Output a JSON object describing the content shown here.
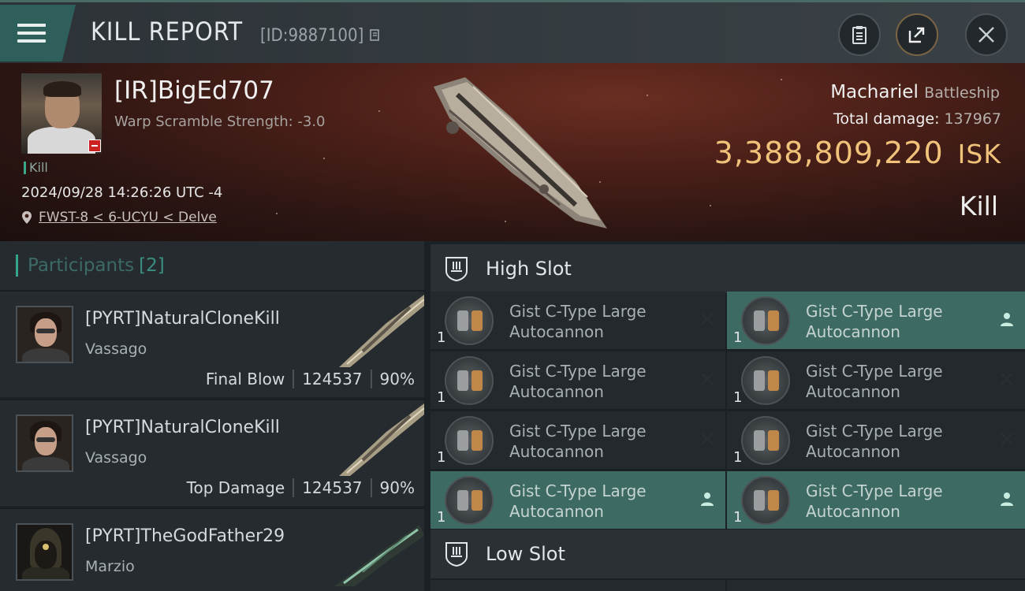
{
  "header": {
    "title": "KILL REPORT",
    "report_id": "[ID:9887100]"
  },
  "victim": {
    "name": "[IR]BigEd707",
    "warp_scramble": "Warp Scramble Strength: -3.0",
    "kill_tag": "Kill",
    "datetime": "2024/09/28 14:26:26 UTC -4",
    "location": "FWST-8 < 6-UCYU < Delve",
    "ship": "Machariel",
    "ship_class": "Battleship",
    "total_damage_label": "Total damage:",
    "total_damage": "137967",
    "isk_value": "3,388,809,220",
    "isk_unit": "ISK",
    "result": "Kill"
  },
  "participants": {
    "label": "Participants",
    "count": "[2]",
    "items": [
      {
        "name": "[PYRT]NaturalCloneKill",
        "ship": "Vassago",
        "role": "Final Blow",
        "damage": "124537",
        "percent": "90%"
      },
      {
        "name": "[PYRT]NaturalCloneKill",
        "ship": "Vassago",
        "role": "Top Damage",
        "damage": "124537",
        "percent": "90%"
      },
      {
        "name": "[PYRT]TheGodFather29",
        "ship": "Marzio",
        "role": "",
        "damage": "",
        "percent": ""
      }
    ]
  },
  "slots": {
    "high_label": "High Slot",
    "low_label": "Low Slot",
    "modules": [
      {
        "line1": "Gist C-Type Large",
        "line2": "Autocannon",
        "qty": "1",
        "status": "destroyed",
        "highlight": false
      },
      {
        "line1": "Gist C-Type Large",
        "line2": "Autocannon",
        "qty": "1",
        "status": "dropped",
        "highlight": true
      },
      {
        "line1": "Gist C-Type Large",
        "line2": "Autocannon",
        "qty": "1",
        "status": "destroyed",
        "highlight": false
      },
      {
        "line1": "Gist C-Type Large",
        "line2": "Autocannon",
        "qty": "1",
        "status": "destroyed",
        "highlight": false
      },
      {
        "line1": "Gist C-Type Large",
        "line2": "Autocannon",
        "qty": "1",
        "status": "destroyed",
        "highlight": false
      },
      {
        "line1": "Gist C-Type Large",
        "line2": "Autocannon",
        "qty": "1",
        "status": "destroyed",
        "highlight": false
      },
      {
        "line1": "Gist C-Type Large",
        "line2": "Autocannon",
        "qty": "1",
        "status": "dropped",
        "highlight": true
      },
      {
        "line1": "Gist C-Type Large",
        "line2": "Autocannon",
        "qty": "1",
        "status": "dropped",
        "highlight": true
      }
    ]
  },
  "colors": {
    "accent_teal": "#35a58e",
    "isk_gold": "#f1c27a",
    "highlight_row": "#3d6a63"
  },
  "icons": [
    "menu-icon",
    "clipboard-icon",
    "share-icon",
    "close-icon",
    "location-pin-icon",
    "shield-slot-icon",
    "destroyed-x-icon",
    "dropped-person-icon"
  ]
}
